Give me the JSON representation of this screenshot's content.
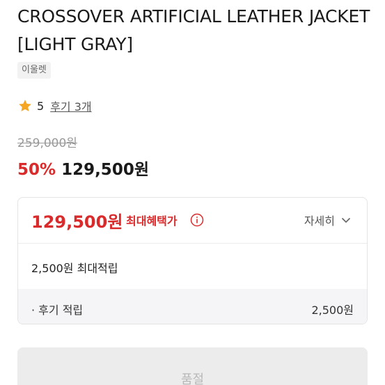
{
  "product": {
    "title": "CROSSOVER ARTIFICIAL LEATHER JACKET [LIGHT GRAY]",
    "brand": "이울렛"
  },
  "rating": {
    "score": "5",
    "review_link": "후기 3개",
    "star_color": "#F5A623"
  },
  "pricing": {
    "original_price": "259,000원",
    "discount_rate": "50%",
    "sale_price": "129,500원",
    "accent_color": "#D92B2B"
  },
  "benefits": {
    "max_benefit_price": "129,500원",
    "max_benefit_label": "최대혜택가",
    "info_icon": "info-icon",
    "detail_toggle": "자세히",
    "point_summary": "2,500원 최대적립",
    "review_point_label": "· 후기 적립",
    "review_point_value": "2,500원"
  },
  "actions": {
    "soldout_label": "품절"
  }
}
